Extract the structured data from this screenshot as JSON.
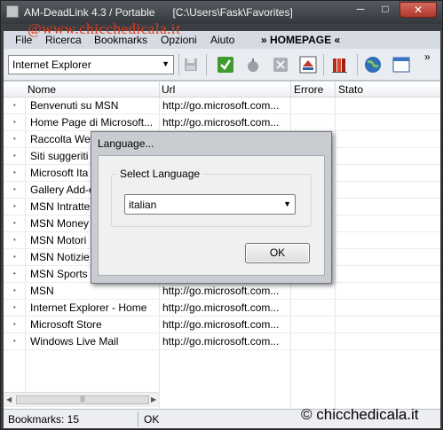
{
  "window": {
    "title": "AM-DeadLink 4.3 / Portable",
    "path": "[C:\\Users\\Fask\\Favorites]",
    "minimize_glyph": "─",
    "maximize_glyph": "□",
    "close_glyph": "✕"
  },
  "watermark_top": "@www.chicchedicala.it",
  "watermark_bottom": "© chicchedicala.it",
  "menu": {
    "items": [
      "File",
      "Ricerca",
      "Bookmarks",
      "Opzioni",
      "Aiuto"
    ],
    "homepage": "» HOMEPAGE «"
  },
  "toolbar": {
    "browser": "Internet Explorer",
    "overflow": "»",
    "icons": [
      "save-icon",
      "check-icon",
      "apple-icon",
      "cancel-icon",
      "home-icon",
      "books-icon",
      "globe-icon",
      "window-icon"
    ]
  },
  "columns": [
    "Nome",
    "Url",
    "Errore",
    "Stato"
  ],
  "rows": [
    {
      "name": "Benvenuti su MSN",
      "url": "http://go.microsoft.com..."
    },
    {
      "name": "Home Page di Microsoft...",
      "url": "http://go.microsoft.com..."
    },
    {
      "name": "Raccolta Web",
      "url": ""
    },
    {
      "name": "Siti suggeriti",
      "url": ""
    },
    {
      "name": "Microsoft Ita",
      "url": ""
    },
    {
      "name": "Gallery Add-o",
      "url": ""
    },
    {
      "name": "MSN Intratte",
      "url": ""
    },
    {
      "name": "MSN Money",
      "url": ""
    },
    {
      "name": "MSN Motori",
      "url": ""
    },
    {
      "name": "MSN Notizie",
      "url": ""
    },
    {
      "name": "MSN Sports",
      "url": ""
    },
    {
      "name": "MSN",
      "url": "http://go.microsoft.com..."
    },
    {
      "name": "Internet Explorer - Home",
      "url": "http://go.microsoft.com..."
    },
    {
      "name": "Microsoft Store",
      "url": "http://go.microsoft.com..."
    },
    {
      "name": "Windows Live Mail",
      "url": "http://go.microsoft.com..."
    }
  ],
  "status": {
    "bookmarks": "Bookmarks: 15",
    "state": "OK"
  },
  "dialog": {
    "title": "Language...",
    "group_label": "Select Language",
    "selected": "italian",
    "ok": "OK"
  },
  "colors": {
    "titlebar": "#3b3f44",
    "close": "#c0392b",
    "watermark": "#e03a1a"
  }
}
